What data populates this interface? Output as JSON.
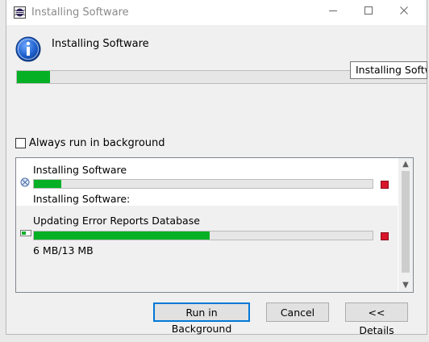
{
  "window": {
    "title": "Installing Software"
  },
  "header": {
    "label": "Installing Software",
    "progress_percent": 8
  },
  "tooltip": {
    "text": "Installing Software"
  },
  "background_option": {
    "label": "Always run in background",
    "checked": false
  },
  "jobs": [
    {
      "name": "Installing Software",
      "progress_percent": 8,
      "detail": "Installing Software:"
    },
    {
      "name": "Updating Error Reports Database",
      "progress_percent": 52,
      "detail": "6 MB/13 MB"
    }
  ],
  "buttons": {
    "run_in_background": "Run in Background",
    "cancel": "Cancel",
    "details": "<< Details"
  },
  "colors": {
    "progress_fill": "#06b025",
    "stop_red": "#d9152c",
    "focus_border": "#0078d7"
  }
}
